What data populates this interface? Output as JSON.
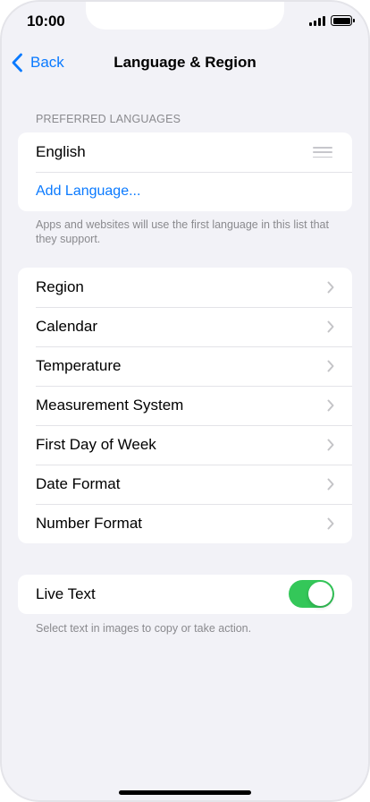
{
  "status_bar": {
    "time": "10:00",
    "signal_icon": "cellular-signal-icon",
    "battery_icon": "battery-icon",
    "battery_level": 1.0
  },
  "nav": {
    "back_label": "Back",
    "title": "Language & Region",
    "back_icon": "chevron-left-icon"
  },
  "languages": {
    "header": "PREFERRED LANGUAGES",
    "items": [
      {
        "label": "English",
        "icon": "reorder-handle-icon"
      }
    ],
    "add_label": "Add Language...",
    "footer": "Apps and websites will use the first language in this list that they support."
  },
  "settings": {
    "items": [
      {
        "label": "Region"
      },
      {
        "label": "Calendar"
      },
      {
        "label": "Temperature"
      },
      {
        "label": "Measurement System"
      },
      {
        "label": "First Day of Week"
      },
      {
        "label": "Date Format"
      },
      {
        "label": "Number Format"
      }
    ],
    "chevron_icon": "chevron-right-icon"
  },
  "live_text": {
    "label": "Live Text",
    "enabled": true,
    "footer": "Select text in images to copy or take action."
  },
  "colors": {
    "accent": "#0a7aff",
    "toggle_on": "#34c759",
    "background": "#f2f2f7"
  }
}
